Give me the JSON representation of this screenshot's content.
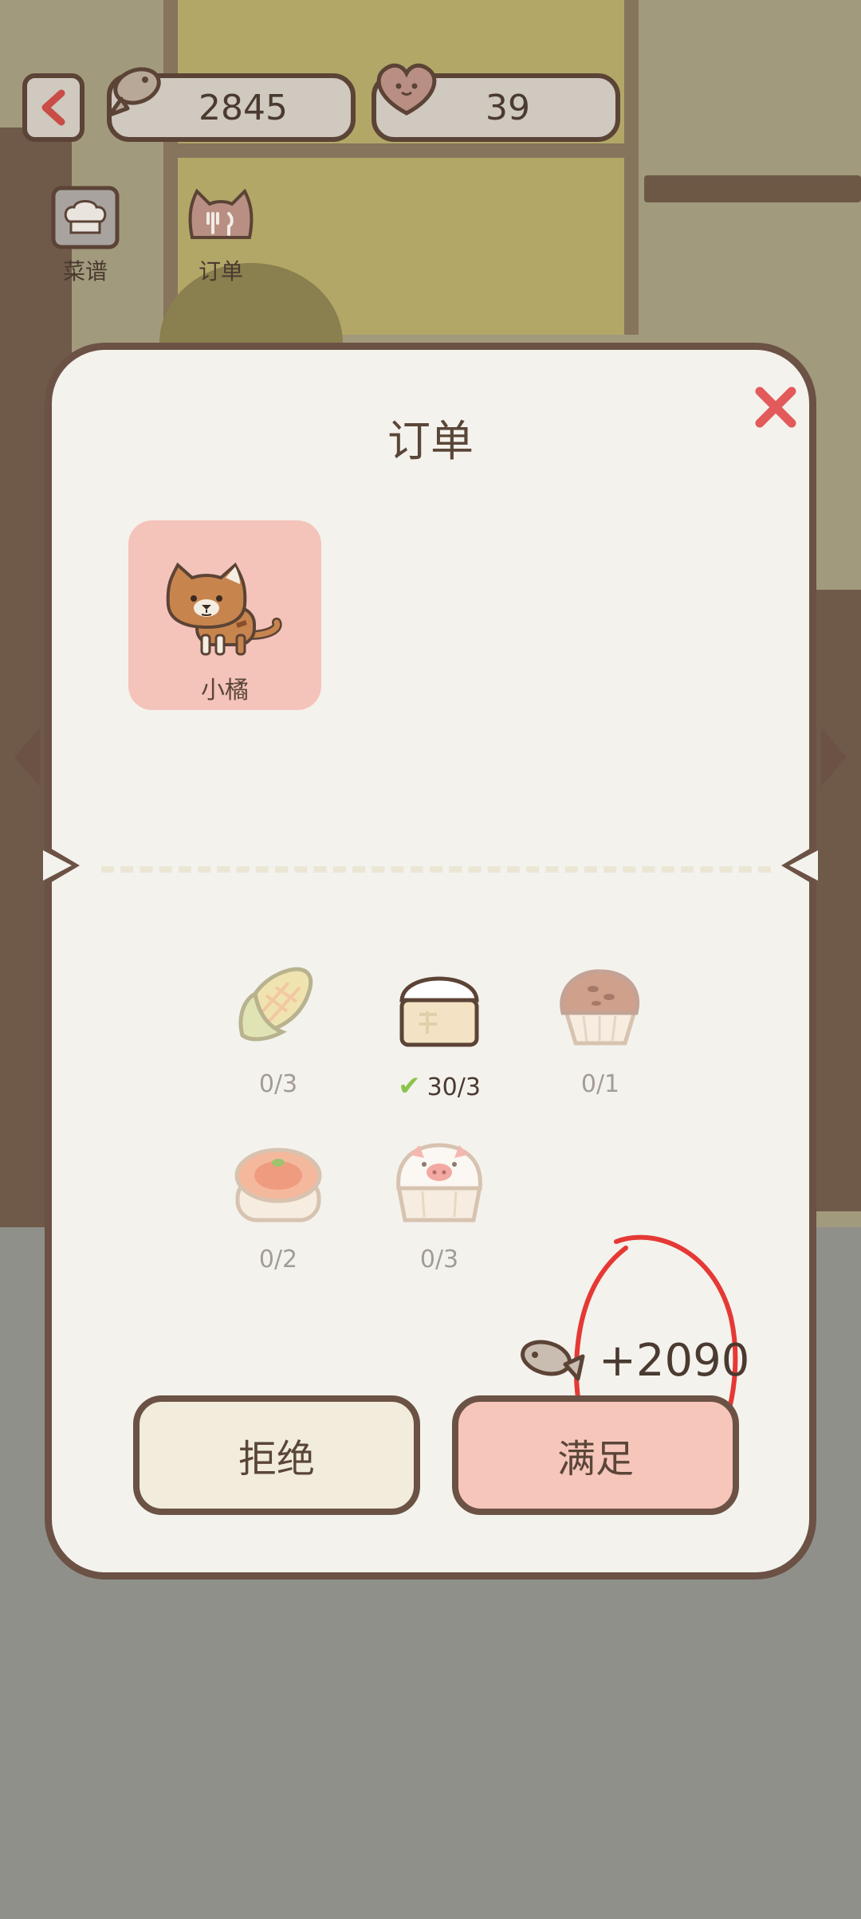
{
  "hud": {
    "fish_count": "2845",
    "heart_count": "39"
  },
  "side_buttons": {
    "recipe_label": "菜谱",
    "order_label": "订单"
  },
  "dialog": {
    "title": "订单",
    "customer": {
      "name": "小橘"
    },
    "dishes": [
      {
        "icon": "corn-icon",
        "progress": "0/3",
        "completed": false
      },
      {
        "icon": "rice-steamer-icon",
        "progress": "30/3",
        "completed": true
      },
      {
        "icon": "muffin-icon",
        "progress": "0/1",
        "completed": false
      },
      {
        "icon": "siumai-icon",
        "progress": "0/2",
        "completed": false
      },
      {
        "icon": "pig-bun-icon",
        "progress": "0/3",
        "completed": false
      }
    ],
    "reward": "+2090",
    "reject_label": "拒绝",
    "accept_label": "满足"
  },
  "colors": {
    "accent_red": "#e25a5a",
    "outline_brown": "#6b5244",
    "accept_pink": "#f7c6ba",
    "reject_cream": "#f1ecdc"
  }
}
